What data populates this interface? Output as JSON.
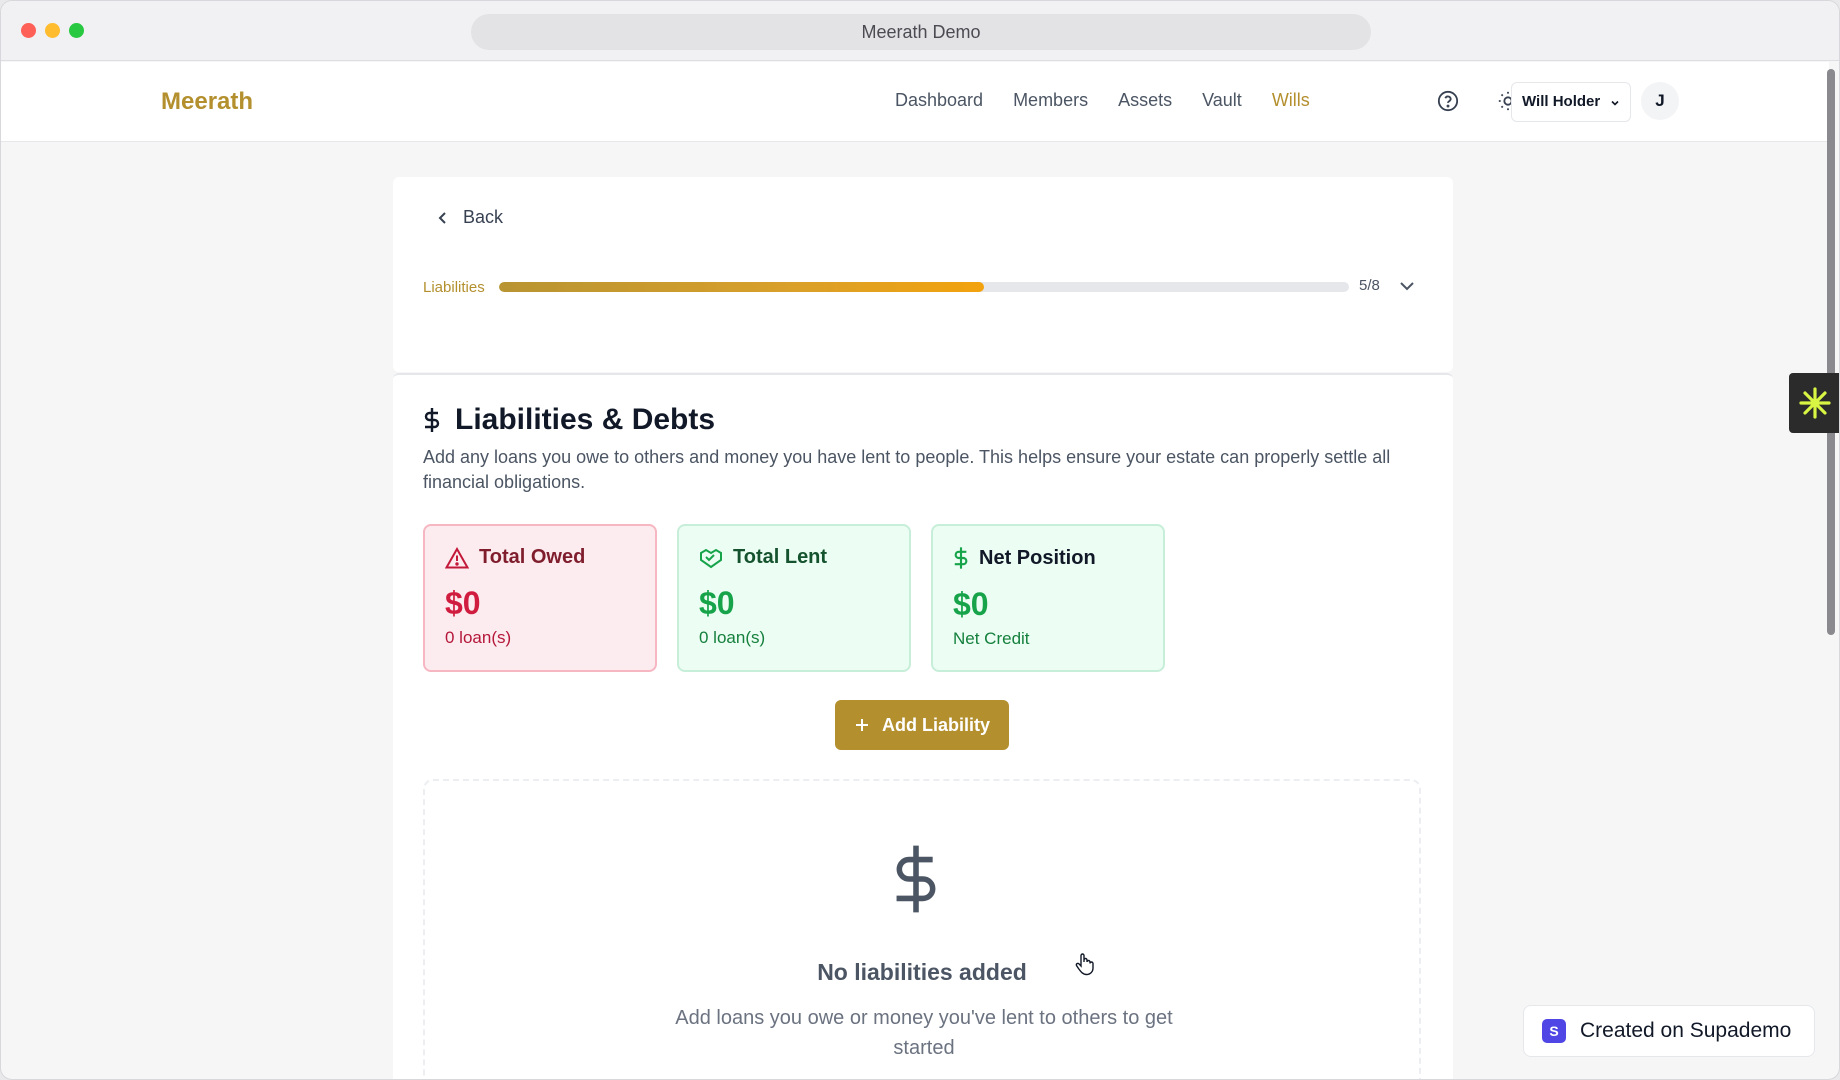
{
  "window": {
    "title": "Meerath Demo"
  },
  "header": {
    "brand": "Meerath",
    "nav": [
      {
        "label": "Dashboard",
        "active": false
      },
      {
        "label": "Members",
        "active": false
      },
      {
        "label": "Assets",
        "active": false
      },
      {
        "label": "Vault",
        "active": false
      },
      {
        "label": "Wills",
        "active": true
      }
    ],
    "user_menu_label": "Will Holder",
    "avatar_initial": "J"
  },
  "wizard": {
    "back_label": "Back",
    "step_label": "Liabilities",
    "step_count": "5/8",
    "progress_fraction": 0.571
  },
  "section": {
    "title": "Liabilities & Debts",
    "description": "Add any loans you owe to others and money you have lent to people. This helps ensure your estate can properly settle all financial obligations."
  },
  "cards": {
    "owed": {
      "title": "Total Owed",
      "value": "$0",
      "sub": "0 loan(s)"
    },
    "lent": {
      "title": "Total Lent",
      "value": "$0",
      "sub": "0 loan(s)"
    },
    "net": {
      "title": "Net Position",
      "value": "$0",
      "sub": "Net Credit"
    }
  },
  "add_button_label": "Add Liability",
  "empty_state": {
    "title": "No liabilities added",
    "description": "Add loans you owe or money you've lent to others to get started"
  },
  "supademo_label": "Created on Supademo",
  "colors": {
    "accent": "#b38f2e",
    "danger": "#d01c3f",
    "success": "#16a34a"
  }
}
